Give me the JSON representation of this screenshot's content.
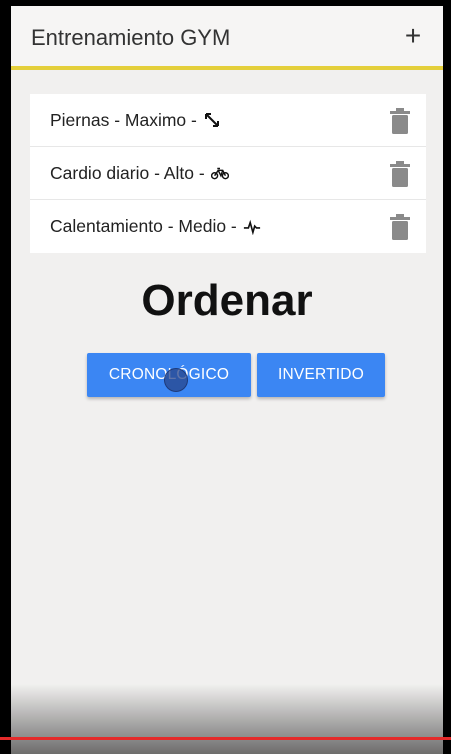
{
  "app": {
    "title": "Entrenamiento GYM",
    "add_label": "+",
    "accent_color": "#e4cf3a"
  },
  "workouts": [
    {
      "label": "Piernas - Maximo -",
      "icon": "arrow-diagonal-icon"
    },
    {
      "label": "Cardio diario - Alto -",
      "icon": "bicycle-icon"
    },
    {
      "label": "Calentamiento - Medio -",
      "icon": "heartbeat-icon"
    }
  ],
  "sort": {
    "heading": "Ordenar",
    "chronological_label": "CRONOLÓGICO",
    "inverted_label": "INVERTIDO",
    "button_color": "#3b86f3"
  },
  "video": {
    "progress_color": "#e42a2a"
  }
}
